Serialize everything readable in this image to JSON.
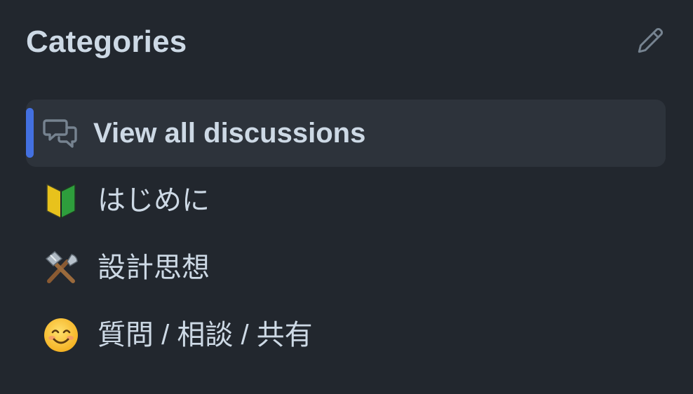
{
  "header": {
    "title": "Categories",
    "edit_icon": "pencil-icon"
  },
  "categories": [
    {
      "label": "View all discussions",
      "icon": "discussions-icon",
      "active": true
    },
    {
      "label": "はじめに",
      "icon": "beginner-mark-icon",
      "active": false
    },
    {
      "label": "設計思想",
      "icon": "hammer-and-wrench-icon",
      "active": false
    },
    {
      "label": "質問 / 相談 / 共有",
      "icon": "smiling-face-icon",
      "active": false
    }
  ],
  "colors": {
    "background": "#22272e",
    "active_row": "#2d333b",
    "accent_bar": "#4370e0",
    "text": "#cdd9e5",
    "icon_muted": "#768390"
  }
}
